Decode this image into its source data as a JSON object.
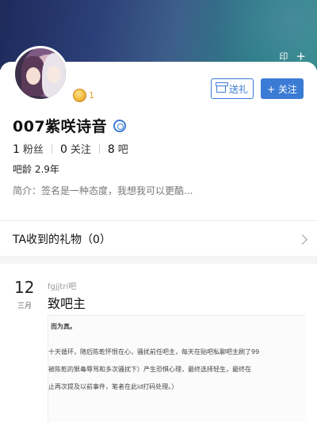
{
  "header": {
    "icon_left": "印",
    "icon_right": "+"
  },
  "profile": {
    "name": "007紫咲诗音",
    "level": "1",
    "gift_button": "送礼",
    "follow_button": "+ 关注",
    "stats": [
      {
        "value": "1",
        "label": "粉丝"
      },
      {
        "value": "0",
        "label": "关注"
      },
      {
        "value": "8",
        "label": "吧"
      }
    ],
    "bar_age": "吧龄 2.9年",
    "intro": "简介：签名是一种态度，我想我可以更酷..."
  },
  "gifts": {
    "label": "TA收到的礼物（0）"
  },
  "post": {
    "day": "12",
    "month": "三月",
    "forum": "fgjjtri吧",
    "title": "致吧主",
    "screenshot_lines": [
      "而为真。",
      "十天循环，随后陈乾怀恨在心，骚扰前任吧主，每天在贴吧私聊吧主刷了99",
      "被陈乾的狠毒辱骂和多次骚扰下）产生恐惧心理，最终选择轻生，最终在",
      "止再次提及以前事件，笔者在此id打码处理。）"
    ]
  }
}
